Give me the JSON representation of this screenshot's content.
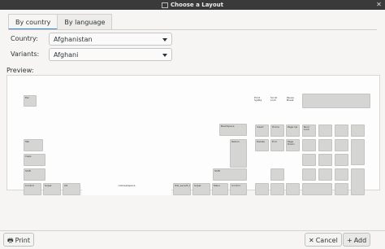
{
  "window": {
    "title": "Choose a Layout"
  },
  "tabs": [
    {
      "label": "By country"
    },
    {
      "label": "By language"
    }
  ],
  "form": {
    "country": {
      "label": "Country:",
      "value": "Afghanistan"
    },
    "variants": {
      "label": "Variants:",
      "value": "Afghani"
    }
  },
  "preview": {
    "label": "Preview:",
    "keys": {
      "esc": "Esc",
      "backspace": "BackSpace",
      "tab": "Tab",
      "return": "Return",
      "caps": "Caps",
      "shift_l": "Shift",
      "shift_r": "Shift",
      "control_l": "Control",
      "super_l": "Super",
      "alt": "Alt",
      "space": "nobreakspace",
      "iso_level3": "ISO_Level3_Shift",
      "super_r": "Super",
      "menu": "Menu",
      "control_r": "Control",
      "print": "Print SysRq",
      "scroll": "Scroll Lock",
      "pause": "Pause Break",
      "insert": "Insert",
      "home": "Home",
      "pageup": "Page Up",
      "delete": "Delete",
      "end": "End",
      "pagedown": "Page Down",
      "numlock": "Num Lock"
    }
  },
  "buttons": {
    "print": "Print",
    "cancel": "Cancel",
    "add": "Add"
  }
}
